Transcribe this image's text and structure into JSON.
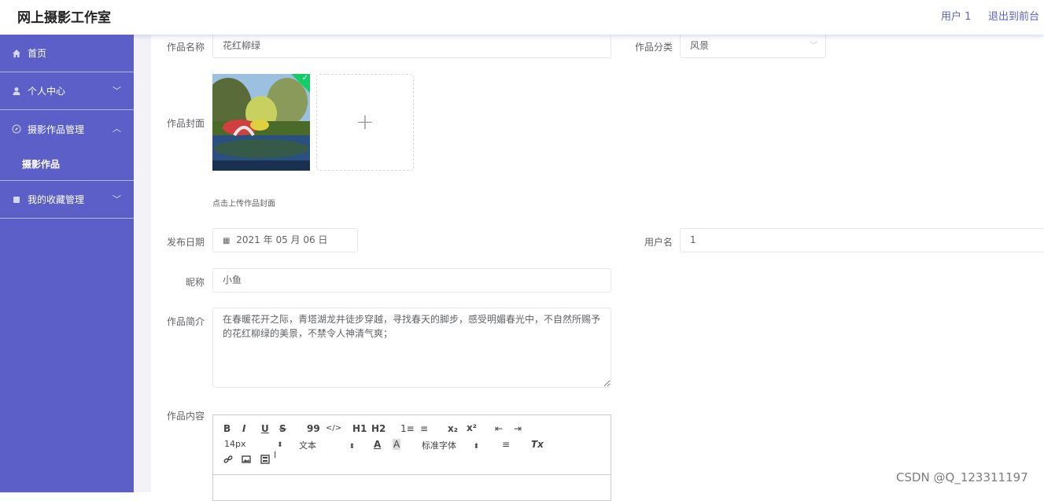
{
  "app": {
    "title": "网上摄影工作室",
    "user_label": "用户 1",
    "logout_label": "退出到前台"
  },
  "sidebar": {
    "items": [
      {
        "label": "首页",
        "icon": "home-icon"
      },
      {
        "label": "个人中心",
        "icon": "user-icon"
      },
      {
        "label": "摄影作品管理",
        "icon": "compass-icon"
      },
      {
        "label": "摄影作品",
        "icon": ""
      },
      {
        "label": "我的收藏管理",
        "icon": "folder-icon"
      }
    ]
  },
  "form": {
    "name_label": "作品名称",
    "name_value": "花红柳绿",
    "category_label": "作品分类",
    "category_value": "风景",
    "cover_label": "作品封面",
    "cover_hint": "点击上传作品封面",
    "date_label": "发布日期",
    "date_value": "2021 年 05 月 06 日",
    "username_label": "用户名",
    "username_value": "1",
    "nickname_label": "昵称",
    "nickname_value": "小鱼",
    "intro_label": "作品简介",
    "intro_value": "在春暖花开之际，青塔湖龙井徒步穿越，寻找春天的脚步，感受明媚春光中，不自然所赐予的花红柳绿的美景，不禁令人神清气爽；",
    "content_label": "作品内容"
  },
  "editor": {
    "font_size": "14px",
    "text_type": "文本",
    "font_family": "标准字体",
    "buttons": [
      "B",
      "I",
      "U",
      "S",
      "99",
      "</>",
      "H1",
      "H2",
      "1≡",
      "≡",
      "x₂",
      "x²",
      "⇤",
      "⇥",
      "A",
      "A",
      "≡",
      "Tx"
    ]
  },
  "watermark": "CSDN @Q_123311197",
  "colors": {
    "sidebar": "#5b5fc7",
    "accent": "#5a62c8",
    "success": "#13ce66"
  }
}
